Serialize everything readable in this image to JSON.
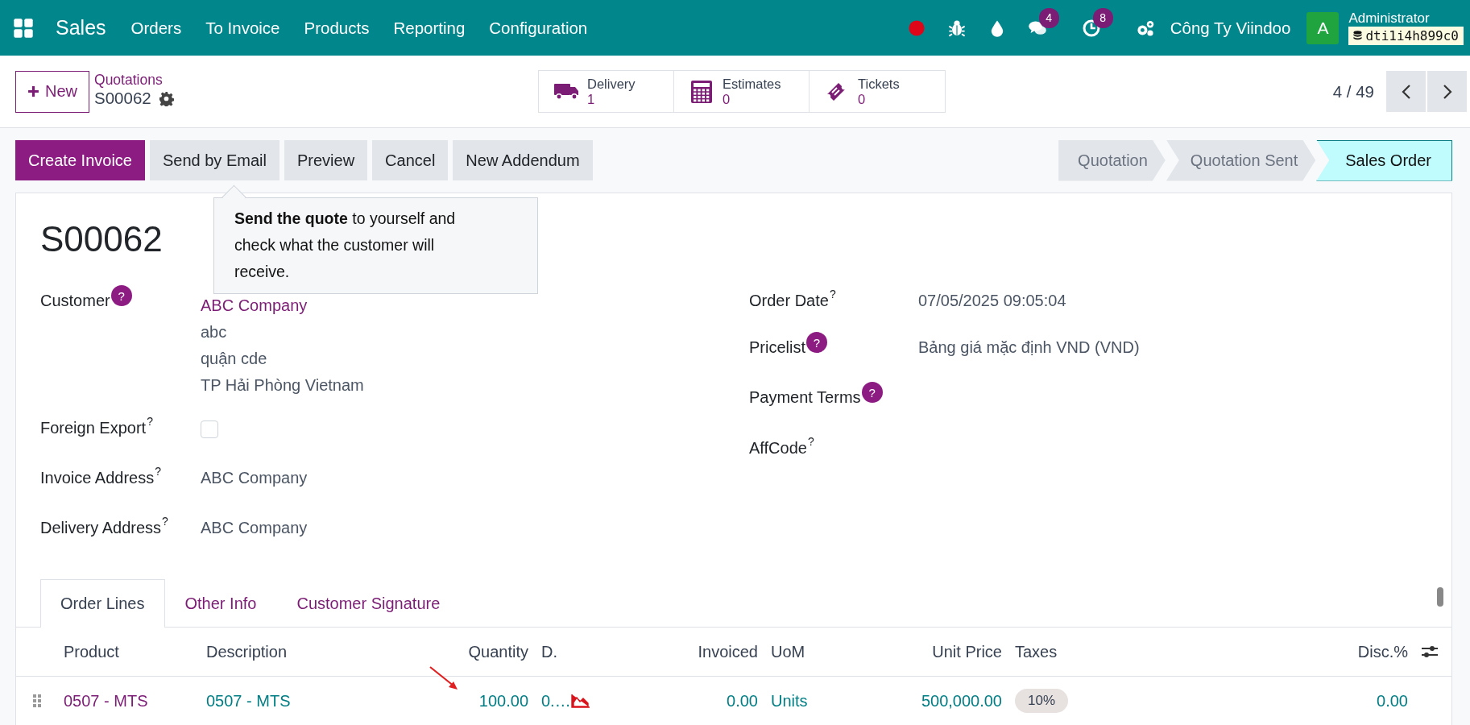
{
  "navbar": {
    "app_name": "Sales",
    "menu": [
      "Orders",
      "To Invoice",
      "Products",
      "Reporting",
      "Configuration"
    ],
    "systray": [
      {
        "kind": "record"
      },
      {
        "kind": "debug"
      },
      {
        "kind": "drop"
      },
      {
        "kind": "chat",
        "badge": "4"
      },
      {
        "kind": "activity",
        "badge": "8"
      },
      {
        "kind": "settings"
      }
    ],
    "company": "Công Ty Viindoo",
    "avatar": "A",
    "user": "Administrator",
    "database": "dti1i4h899c0"
  },
  "control_panel": {
    "new_button": "New",
    "breadcrumb": "Quotations",
    "record": "S00062",
    "smart_buttons": [
      {
        "kind": "truck",
        "label": "Delivery",
        "value": "1"
      },
      {
        "kind": "calculator",
        "label": "Estimates",
        "value": "0"
      },
      {
        "kind": "ticket",
        "label": "Tickets",
        "value": "0"
      }
    ],
    "pager": "4 / 49"
  },
  "action_buttons": [
    {
      "label": "Create Invoice",
      "primary": true
    },
    {
      "label": "Send by Email",
      "primary": false
    },
    {
      "label": "Preview",
      "primary": false
    },
    {
      "label": "Cancel",
      "primary": false
    },
    {
      "label": "New Addendum",
      "primary": false
    }
  ],
  "statusbar": [
    {
      "label": "Quotation",
      "selected": false
    },
    {
      "label": "Quotation Sent",
      "selected": false
    },
    {
      "label": "Sales Order",
      "selected": true
    }
  ],
  "tooltip": "**Send the quote** to yourself and check what the customer will receive.",
  "form": {
    "title": "S00062",
    "left_fields": [
      {
        "label": "Customer",
        "help": {
          "kind": "badge",
          "text": "?"
        },
        "kind": "address",
        "lines": [
          "ABC Company",
          "abc",
          "quận cde",
          "TP Hải Phòng Vietnam"
        ]
      },
      {
        "label": "Foreign Export",
        "help": {
          "kind": "sup",
          "text": "?"
        },
        "kind": "checkbox",
        "checked": false
      },
      {
        "label": "Invoice Address",
        "help": {
          "kind": "sup",
          "text": "?"
        },
        "kind": "text",
        "value": "ABC Company"
      },
      {
        "label": "Delivery Address",
        "help": {
          "kind": "sup",
          "text": "?"
        },
        "kind": "text",
        "value": "ABC Company"
      }
    ],
    "right_fields": [
      {
        "label": "Order Date",
        "help": {
          "kind": "sup",
          "text": "?"
        },
        "kind": "text",
        "value": "07/05/2025 09:05:04"
      },
      {
        "label": "Pricelist",
        "help": {
          "kind": "badge",
          "text": "?"
        },
        "kind": "text",
        "value": "Bảng giá mặc định VND (VND)"
      },
      {
        "label": "Payment Terms",
        "help": {
          "kind": "badge",
          "text": "?"
        },
        "kind": "text"
      },
      {
        "label": "AffCode",
        "help": {
          "kind": "sup",
          "text": "?"
        },
        "kind": "text"
      }
    ]
  },
  "tabs": [
    {
      "label": "Order Lines",
      "selected": true
    },
    {
      "label": "Other Info",
      "selected": false
    },
    {
      "label": "Customer Signature",
      "selected": false
    }
  ],
  "table": {
    "columns": [
      {
        "label": "Product",
        "kind": "text"
      },
      {
        "label": "Description",
        "kind": "text"
      },
      {
        "label": "Quantity",
        "kind": "number"
      },
      {
        "label": "D.",
        "kind": "text"
      },
      {
        "kind": "icon"
      },
      {
        "label": "Invoiced",
        "kind": "number"
      },
      {
        "label": "UoM",
        "kind": "text"
      },
      {
        "label": "Unit Price",
        "kind": "number"
      },
      {
        "label": "Taxes",
        "kind": "text"
      },
      {
        "label": "Disc.%",
        "kind": "number"
      }
    ],
    "rows": [
      {
        "cells": [
          {
            "kind": "product",
            "text": "0507 - MTS"
          },
          {
            "kind": "link",
            "text": "0507 - MTS"
          },
          {
            "kind": "link",
            "text": "100.00"
          },
          {
            "kind": "link",
            "text": "0.…"
          },
          {
            "kind": "chart"
          },
          {
            "kind": "link",
            "text": "0.00"
          },
          {
            "kind": "link",
            "text": "Units"
          },
          {
            "kind": "link",
            "text": "500,000.00"
          },
          {
            "kind": "tag",
            "text": "10%"
          },
          {
            "kind": "link",
            "text": "0.00"
          }
        ]
      }
    ]
  }
}
